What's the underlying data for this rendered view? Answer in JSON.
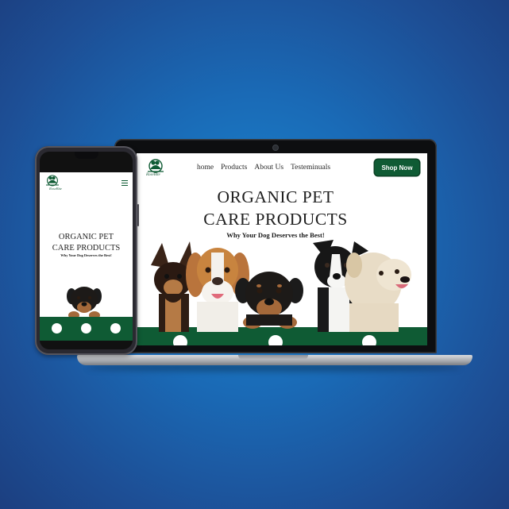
{
  "site": {
    "logo_text": "RoseBite",
    "nav": [
      "home",
      "Products",
      "About Us",
      "Testeminuals"
    ],
    "shop_button": "Shop Now",
    "hero_title_line1": "ORGANIC PET",
    "hero_title_line2": "CARE PRODUCTS",
    "hero_subtitle": "Why Your Dog Deserves the Best!"
  },
  "colors": {
    "brand_green": "#0f5b34",
    "background_blue": "#1a6ab6",
    "device_dark": "#0d0e10"
  },
  "icons": {
    "logo": "dog-bowl-logo-icon",
    "menu": "hamburger-menu-icon",
    "feature_1": "dog-icon",
    "feature_2": "cat-icon",
    "feature_3": "bone-icon"
  }
}
